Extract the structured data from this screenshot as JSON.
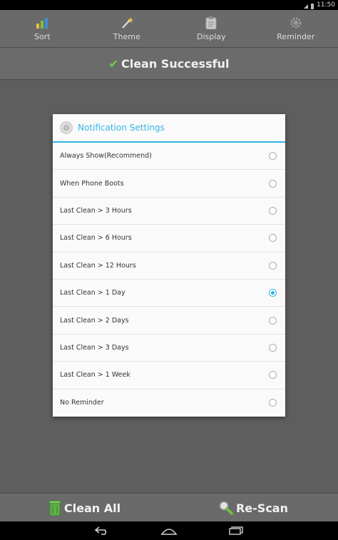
{
  "status": {
    "time": "11:50"
  },
  "toolbar": {
    "items": [
      {
        "label": "Sort",
        "icon": "bar-chart-icon"
      },
      {
        "label": "Theme",
        "icon": "magic-wand-icon"
      },
      {
        "label": "Display",
        "icon": "clipboard-icon"
      },
      {
        "label": "Reminder",
        "icon": "gear-icon"
      }
    ]
  },
  "banner": {
    "text": "Clean Successful",
    "check_color": "#6fd04a"
  },
  "dialog": {
    "title": "Notification Settings",
    "accent": "#33b5e5",
    "options": [
      {
        "label": "Always Show(Recommend)",
        "selected": false
      },
      {
        "label": "When Phone Boots",
        "selected": false
      },
      {
        "label": "Last Clean > 3 Hours",
        "selected": false
      },
      {
        "label": "Last Clean > 6 Hours",
        "selected": false
      },
      {
        "label": "Last Clean > 12 Hours",
        "selected": false
      },
      {
        "label": "Last Clean > 1 Day",
        "selected": true
      },
      {
        "label": "Last Clean > 2 Days",
        "selected": false
      },
      {
        "label": "Last Clean > 3 Days",
        "selected": false
      },
      {
        "label": "Last Clean > 1 Week",
        "selected": false
      },
      {
        "label": "No Reminder",
        "selected": false
      }
    ]
  },
  "bottom": {
    "clean_all_label": "Clean All",
    "rescan_label": "Re-Scan"
  },
  "navbar": {
    "icons": [
      "back-icon",
      "home-icon",
      "recent-apps-icon"
    ]
  }
}
